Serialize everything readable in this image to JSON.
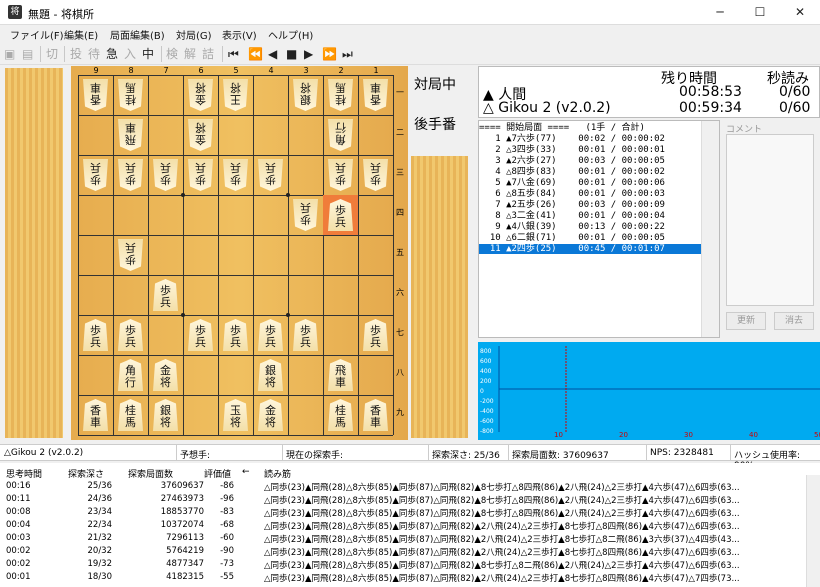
{
  "window": {
    "title": "無題 - 将棋所",
    "icon": "shogi-app-icon",
    "min": "─",
    "max": "☐",
    "close": "✕"
  },
  "menu": [
    "ファイル(F)",
    "編集(E)",
    "局面編集(B)",
    "対局(G)",
    "表示(V)",
    "ヘルプ(H)"
  ],
  "toolbar": {
    "kanji": [
      "切",
      "投",
      "待",
      "急",
      "入",
      "中",
      "検",
      "解",
      "詰"
    ],
    "nav": [
      "⏮",
      "⏪",
      "◀",
      "■",
      "▶",
      "⏩",
      "⏭"
    ]
  },
  "board": {
    "files": [
      "9",
      "8",
      "7",
      "6",
      "5",
      "4",
      "3",
      "2",
      "1"
    ],
    "ranks": [
      "一",
      "二",
      "三",
      "四",
      "五",
      "六",
      "七",
      "八",
      "九"
    ],
    "pieces": [
      {
        "f": 9,
        "r": 1,
        "k": "香車",
        "s": "g"
      },
      {
        "f": 8,
        "r": 1,
        "k": "桂馬",
        "s": "g"
      },
      {
        "f": 6,
        "r": 1,
        "k": "金将",
        "s": "g"
      },
      {
        "f": 5,
        "r": 1,
        "k": "王将",
        "s": "g"
      },
      {
        "f": 3,
        "r": 1,
        "k": "銀将",
        "s": "g"
      },
      {
        "f": 2,
        "r": 1,
        "k": "桂馬",
        "s": "g"
      },
      {
        "f": 1,
        "r": 1,
        "k": "香車",
        "s": "g"
      },
      {
        "f": 8,
        "r": 2,
        "k": "飛車",
        "s": "g"
      },
      {
        "f": 6,
        "r": 2,
        "k": "金将",
        "s": "g"
      },
      {
        "f": 2,
        "r": 2,
        "k": "角行",
        "s": "g"
      },
      {
        "f": 9,
        "r": 3,
        "k": "歩兵",
        "s": "g"
      },
      {
        "f": 8,
        "r": 3,
        "k": "歩兵",
        "s": "g"
      },
      {
        "f": 7,
        "r": 3,
        "k": "歩兵",
        "s": "g"
      },
      {
        "f": 6,
        "r": 3,
        "k": "歩兵",
        "s": "g"
      },
      {
        "f": 5,
        "r": 3,
        "k": "歩兵",
        "s": "g"
      },
      {
        "f": 4,
        "r": 3,
        "k": "歩兵",
        "s": "g"
      },
      {
        "f": 2,
        "r": 3,
        "k": "歩兵",
        "s": "g"
      },
      {
        "f": 1,
        "r": 3,
        "k": "歩兵",
        "s": "g"
      },
      {
        "f": 3,
        "r": 4,
        "k": "歩兵",
        "s": "g"
      },
      {
        "f": 2,
        "r": 4,
        "k": "歩兵",
        "s": "s",
        "hi": true
      },
      {
        "f": 8,
        "r": 5,
        "k": "歩兵",
        "s": "g"
      },
      {
        "f": 7,
        "r": 6,
        "k": "歩兵",
        "s": "s"
      },
      {
        "f": 9,
        "r": 7,
        "k": "歩兵",
        "s": "s"
      },
      {
        "f": 8,
        "r": 7,
        "k": "歩兵",
        "s": "s"
      },
      {
        "f": 6,
        "r": 7,
        "k": "歩兵",
        "s": "s"
      },
      {
        "f": 5,
        "r": 7,
        "k": "歩兵",
        "s": "s"
      },
      {
        "f": 4,
        "r": 7,
        "k": "歩兵",
        "s": "s"
      },
      {
        "f": 3,
        "r": 7,
        "k": "歩兵",
        "s": "s"
      },
      {
        "f": 1,
        "r": 7,
        "k": "歩兵",
        "s": "s"
      },
      {
        "f": 8,
        "r": 8,
        "k": "角行",
        "s": "s"
      },
      {
        "f": 7,
        "r": 8,
        "k": "金将",
        "s": "s"
      },
      {
        "f": 4,
        "r": 8,
        "k": "銀将",
        "s": "s"
      },
      {
        "f": 2,
        "r": 8,
        "k": "飛車",
        "s": "s"
      },
      {
        "f": 9,
        "r": 9,
        "k": "香車",
        "s": "s"
      },
      {
        "f": 8,
        "r": 9,
        "k": "桂馬",
        "s": "s"
      },
      {
        "f": 7,
        "r": 9,
        "k": "銀将",
        "s": "s"
      },
      {
        "f": 5,
        "r": 9,
        "k": "玉将",
        "s": "s"
      },
      {
        "f": 4,
        "r": 9,
        "k": "金将",
        "s": "s"
      },
      {
        "f": 2,
        "r": 9,
        "k": "桂馬",
        "s": "s"
      },
      {
        "f": 1,
        "r": 9,
        "k": "香車",
        "s": "s"
      }
    ]
  },
  "status_right": {
    "turn": "対局中",
    "side": "後手番"
  },
  "clock": {
    "h_remaining": "残り時間",
    "h_byoyomi": "秒読み",
    "p1_name": "▲ 人間",
    "p1_time": "00:58:53",
    "p1_byo": "0/60",
    "p2_name": "△ Gikou 2 (v2.0.2)",
    "p2_time": "00:59:34",
    "p2_byo": "0/60"
  },
  "moves": [
    "==== 開始局面 ====   (1手 / 合計)",
    "   1 ▲7六歩(77)    00:02 / 00:00:02",
    "   2 △3四歩(33)    00:01 / 00:00:01",
    "   3 ▲2六歩(27)    00:03 / 00:00:05",
    "   4 △8四歩(83)    00:01 / 00:00:02",
    "   5 ▲7八金(69)    00:01 / 00:00:06",
    "   6 △8五歩(84)    00:01 / 00:00:03",
    "   7 ▲2五歩(26)    00:03 / 00:00:09",
    "   8 △3二金(41)    00:01 / 00:00:04",
    "   9 ▲4八銀(39)    00:13 / 00:00:22",
    "  10 △6二銀(71)    00:01 / 00:00:05",
    "  11 ▲2四歩(25)    00:45 / 00:01:07"
  ],
  "comment": {
    "label": "コメント",
    "update": "更新",
    "clear": "消去"
  },
  "graph": {
    "yticks": [
      "800",
      "600",
      "400",
      "200",
      "0",
      "-200",
      "-400",
      "-600",
      "-800"
    ],
    "xticks": [
      "10",
      "20",
      "30",
      "40",
      "50"
    ]
  },
  "statusbar": {
    "engine": "△Gikou 2 (v2.0.2)",
    "predict": "予想手:",
    "current": "現在の探索手:",
    "depth": "探索深さ: 25/36",
    "nodes": "探索局面数: 37609637",
    "nps": "NPS: 2328481",
    "hash": "ハッシュ使用率: 90%"
  },
  "pv": {
    "headers": [
      "思考時間",
      "探索深さ",
      "探索局面数",
      "評価値",
      "←",
      "読み筋"
    ],
    "rows": [
      [
        "00:16",
        "25/36",
        "37609637",
        "-86",
        "△同歩(23)▲同飛(28)△8六歩(85)▲同歩(87)△同飛(82)▲8七歩打△8四飛(86)▲2八飛(24)△2三歩打▲4六歩(47)△6四歩(63..."
      ],
      [
        "00:11",
        "24/36",
        "27463973",
        "-96",
        "△同歩(23)▲同飛(28)△8六歩(85)▲同歩(87)△同飛(82)▲8七歩打△8四飛(86)▲2八飛(24)△2三歩打▲4六歩(47)△6四歩(63..."
      ],
      [
        "00:08",
        "23/34",
        "18853770",
        "-83",
        "△同歩(23)▲同飛(28)△8六歩(85)▲同歩(87)△同飛(82)▲8七歩打△8四飛(86)▲2八飛(24)△2三歩打▲4六歩(47)△6四歩(63..."
      ],
      [
        "00:04",
        "22/34",
        "10372074",
        "-68",
        "△同歩(23)▲同飛(28)△8六歩(85)▲同歩(87)△同飛(82)▲2八飛(24)△2三歩打▲8七歩打△8四飛(86)▲4六歩(47)△6四歩(63..."
      ],
      [
        "00:03",
        "21/32",
        "7296113",
        "-60",
        "△同歩(23)▲同飛(28)△8六歩(85)▲同歩(87)△同飛(82)▲2八飛(24)△2三歩打▲8七歩打△8二飛(86)▲3六歩(37)△4四歩(43..."
      ],
      [
        "00:02",
        "20/32",
        "5764219",
        "-90",
        "△同歩(23)▲同飛(28)△8六歩(85)▲同歩(87)△同飛(82)▲2八飛(24)△2三歩打▲8七歩打△8四飛(86)▲4六歩(47)△6四歩(63..."
      ],
      [
        "00:02",
        "19/32",
        "4877347",
        "-73",
        "△同歩(23)▲同飛(28)△8六歩(85)▲同歩(87)△同飛(82)▲8七歩打△8二飛(86)▲2八飛(24)△2三歩打▲4六歩(47)△6四歩(63..."
      ],
      [
        "00:01",
        "18/30",
        "4182315",
        "-55",
        "△同歩(23)▲同飛(28)△8六歩(85)▲同歩(87)△同飛(82)▲2八飛(24)△2三歩打▲8七歩打△8四飛(86)▲4六歩(47)△7四歩(73..."
      ]
    ]
  }
}
